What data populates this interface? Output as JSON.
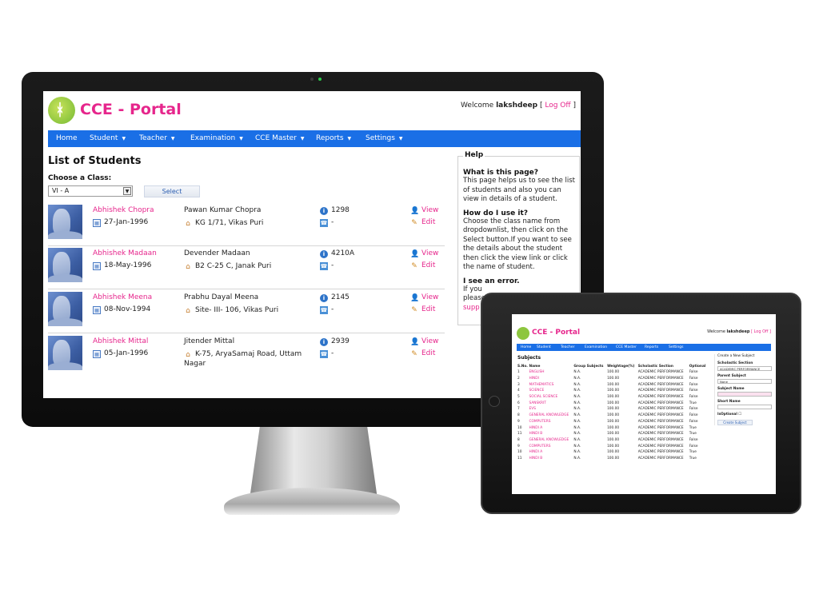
{
  "brand": "CCE - Portal",
  "welcome": {
    "prefix": "Welcome",
    "user": "lakshdeep",
    "open": "[",
    "logoff": "Log Off",
    "close": "]"
  },
  "nav": [
    "Home",
    "Student",
    "Teacher",
    "Examination",
    "CCE Master",
    "Reports",
    "Settings"
  ],
  "page_title": "List of Students",
  "class_label": "Choose a Class:",
  "class_value": "VI - A",
  "select_label": "Select",
  "students": [
    {
      "name": "Abhishek Chopra",
      "dob": "27-Jan-1996",
      "parent": "Pawan Kumar Chopra",
      "address": "KG 1/71, Vikas Puri",
      "id": "1298",
      "phone": "-",
      "view": "View",
      "edit": "Edit"
    },
    {
      "name": "Abhishek Madaan",
      "dob": "18-May-1996",
      "parent": "Devender Madaan",
      "address": "B2 C-25 C, Janak Puri",
      "id": "4210A",
      "phone": "-",
      "view": "View",
      "edit": "Edit"
    },
    {
      "name": "Abhishek Meena",
      "dob": "08-Nov-1994",
      "parent": "Prabhu Dayal Meena",
      "address": "Site- III- 106, Vikas Puri",
      "id": "2145",
      "phone": "-",
      "view": "View",
      "edit": "Edit"
    },
    {
      "name": "Abhishek Mittal",
      "dob": "05-Jan-1996",
      "parent": "Jitender Mittal",
      "address": "K-75, AryaSamaj Road, Uttam Nagar",
      "id": "2939",
      "phone": "-",
      "view": "View",
      "edit": "Edit"
    }
  ],
  "help": {
    "title": "Help",
    "q1": "What is this page?",
    "a1": "This page helps us to see the list of students and also you can view in details of a student.",
    "q2": "How do I use it?",
    "a2": "Choose the class name from dropdownlist, then click on the Select button.If you want to see the details about the student then click the view link or click the name of student.",
    "q3": "I see an error.",
    "a3": "If you",
    "a3b": "please",
    "a3link": "supp"
  },
  "tablet": {
    "brand": "CCE - Portal",
    "welcome_prefix": "Welcome",
    "welcome_user": "lakshdeep",
    "logoff": "[ Log Off ]",
    "nav": [
      "Home",
      "Student",
      "Teacher",
      "Examination",
      "CCE Master",
      "Reports",
      "Settings"
    ],
    "title": "Subjects",
    "columns": [
      "S.No.",
      "Name",
      "Group Subjects",
      "Weightage(%)",
      "Scholastic Section",
      "Optional"
    ],
    "rows": [
      [
        "1",
        "ENGLISH",
        "N.A.",
        "100.00",
        "ACADEMIC PERFORMANCE",
        "False"
      ],
      [
        "2",
        "HINDI",
        "N.A.",
        "100.00",
        "ACADEMIC PERFORMANCE",
        "False"
      ],
      [
        "3",
        "MATHEMATICS",
        "N.A.",
        "100.00",
        "ACADEMIC PERFORMANCE",
        "False"
      ],
      [
        "4",
        "SCIENCE",
        "N.A.",
        "100.00",
        "ACADEMIC PERFORMANCE",
        "False"
      ],
      [
        "5",
        "SOCIAL SCIENCE",
        "N.A.",
        "100.00",
        "ACADEMIC PERFORMANCE",
        "False"
      ],
      [
        "6",
        "SANSKRIT",
        "N.A.",
        "100.00",
        "ACADEMIC PERFORMANCE",
        "True"
      ],
      [
        "7",
        "EVS",
        "N.A.",
        "100.00",
        "ACADEMIC PERFORMANCE",
        "False"
      ],
      [
        "8",
        "GENERAL KNOWLEDGE",
        "N.A.",
        "100.00",
        "ACADEMIC PERFORMANCE",
        "False"
      ],
      [
        "9",
        "COMPUTERS",
        "N.A.",
        "100.00",
        "ACADEMIC PERFORMANCE",
        "False"
      ],
      [
        "10",
        "HINDI A",
        "N.A.",
        "100.00",
        "ACADEMIC PERFORMANCE",
        "True"
      ],
      [
        "11",
        "HINDI B",
        "N.A.",
        "100.00",
        "ACADEMIC PERFORMANCE",
        "True"
      ],
      [
        "8",
        "GENERAL KNOWLEDGE",
        "N.A.",
        "100.00",
        "ACADEMIC PERFORMANCE",
        "False"
      ],
      [
        "9",
        "COMPUTERS",
        "N.A.",
        "100.00",
        "ACADEMIC PERFORMANCE",
        "False"
      ],
      [
        "10",
        "HINDI A",
        "N.A.",
        "100.00",
        "ACADEMIC PERFORMANCE",
        "True"
      ],
      [
        "11",
        "HINDI B",
        "N.A.",
        "100.00",
        "ACADEMIC PERFORMANCE",
        "True"
      ]
    ],
    "form": {
      "heading": "Create a New Subject",
      "scholastic_label": "Scholastic Section",
      "scholastic_value": "ACADEMIC PERFORMANCE",
      "parent_label": "Parent Subject",
      "parent_value": "None",
      "name_label": "Subject Name",
      "short_label": "Short Name",
      "optional_label": "IsOptional",
      "create_label": "Create Subject"
    }
  },
  "colors": {
    "accent": "#e6268c",
    "nav": "#1a6fe6",
    "logo": "#8dc63f"
  }
}
